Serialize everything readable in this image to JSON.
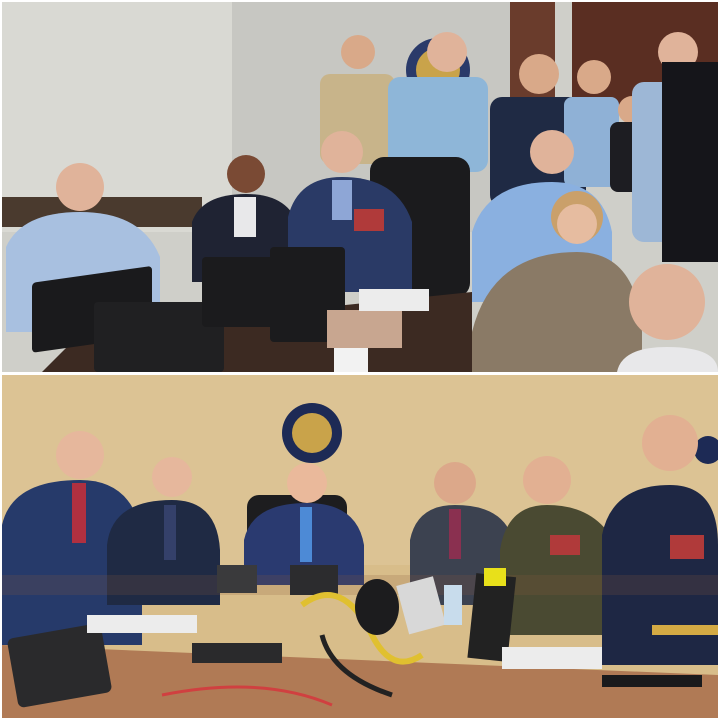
{
  "photos": [
    {
      "id": "top-photo",
      "scene": "situation-room-meeting"
    },
    {
      "id": "bottom-photo",
      "scene": "situation-room-meeting"
    }
  ],
  "colors": {
    "top_wall": "#cfcfc9",
    "top_wood": "#5a3a2a",
    "bottom_wall": "#d8bd8a",
    "bottom_table": "#b07a55",
    "navy_suit": "#1f2a44",
    "uniform_blue": "#2a3a66",
    "army_green": "#4a4a32",
    "skin": "#d9a989"
  }
}
